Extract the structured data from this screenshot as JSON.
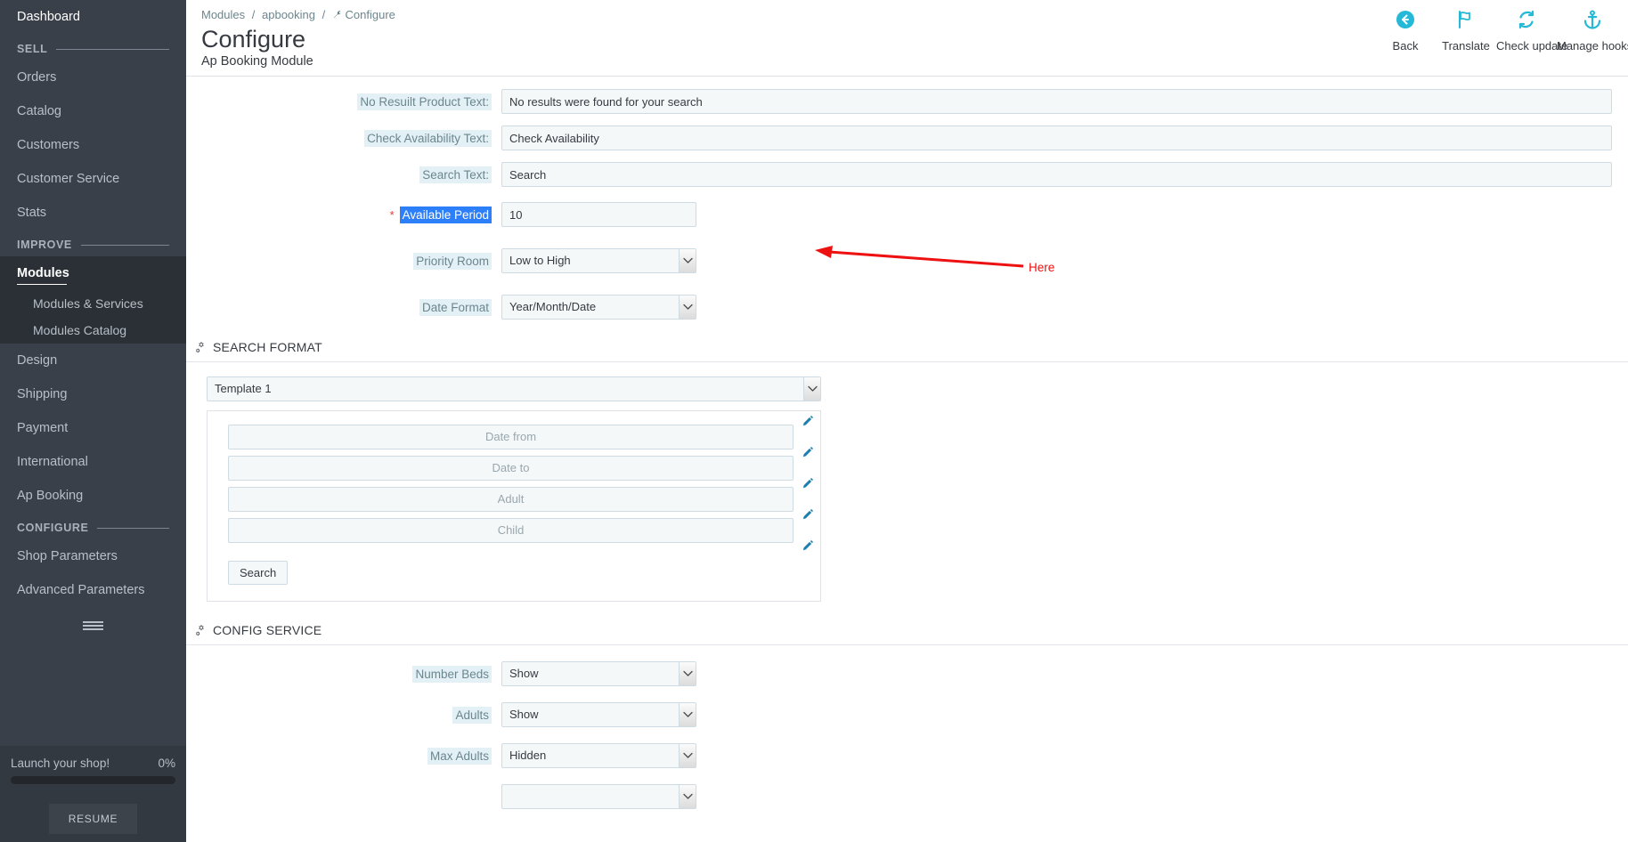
{
  "sidebar": {
    "dashboard": "Dashboard",
    "sections": [
      {
        "title": "SELL",
        "items": [
          {
            "label": "Orders"
          },
          {
            "label": "Catalog"
          },
          {
            "label": "Customers"
          },
          {
            "label": "Customer Service"
          },
          {
            "label": "Stats"
          }
        ]
      },
      {
        "title": "IMPROVE",
        "items": [
          {
            "label": "Modules",
            "active": true,
            "sub": [
              {
                "label": "Modules & Services"
              },
              {
                "label": "Modules Catalog"
              }
            ]
          },
          {
            "label": "Design"
          },
          {
            "label": "Shipping"
          },
          {
            "label": "Payment"
          },
          {
            "label": "International"
          },
          {
            "label": "Ap Booking"
          }
        ]
      },
      {
        "title": "CONFIGURE",
        "items": [
          {
            "label": "Shop Parameters"
          },
          {
            "label": "Advanced Parameters"
          }
        ]
      }
    ],
    "footer": {
      "launch_label": "Launch your shop!",
      "progress_text": "0%",
      "progress_value": 0,
      "resume_label": "RESUME"
    }
  },
  "header": {
    "breadcrumb": [
      "Modules",
      "apbooking",
      "Configure"
    ],
    "title": "Configure",
    "subtitle": "Ap Booking Module",
    "toolbar": [
      {
        "label": "Back",
        "icon": "back-circle-icon"
      },
      {
        "label": "Translate",
        "icon": "flag-icon"
      },
      {
        "label": "Check update",
        "icon": "refresh-icon"
      },
      {
        "label": "Manage hooks",
        "icon": "anchor-icon"
      }
    ]
  },
  "form": {
    "rows": [
      {
        "label": "No Resuilt Product Text:",
        "type": "text",
        "value": "No results were found for your search"
      },
      {
        "label": "Check Availability Text:",
        "type": "text",
        "value": "Check Availability"
      },
      {
        "label": "Search Text:",
        "type": "text",
        "value": "Search"
      },
      {
        "label": "Available Period",
        "type": "text-short",
        "value": "10",
        "required": true,
        "selected": true
      },
      {
        "label": "Priority Room",
        "type": "select",
        "value": "Low to High"
      },
      {
        "label": "Date Format",
        "type": "select",
        "value": "Year/Month/Date"
      }
    ]
  },
  "search_format": {
    "heading": "SEARCH FORMAT",
    "template_value": "Template 1",
    "preview_fields": [
      "Date from",
      "Date to",
      "Adult",
      "Child"
    ],
    "search_button": "Search",
    "edit_icon": "pencil-icon"
  },
  "config_service": {
    "heading": "CONFIG SERVICE",
    "rows": [
      {
        "label": "Number Beds",
        "value": "Show"
      },
      {
        "label": "Adults",
        "value": "Show"
      },
      {
        "label": "Max Adults",
        "value": "Hidden"
      }
    ]
  },
  "annotation": {
    "text": "Here",
    "color": "#ee1111"
  },
  "colors": {
    "accent": "#25b9d7",
    "sidebar_bg": "#3a4049",
    "label_bg": "#e3f1f7",
    "label_fg": "#6c868e",
    "selection_bg": "#2d7ff9"
  }
}
